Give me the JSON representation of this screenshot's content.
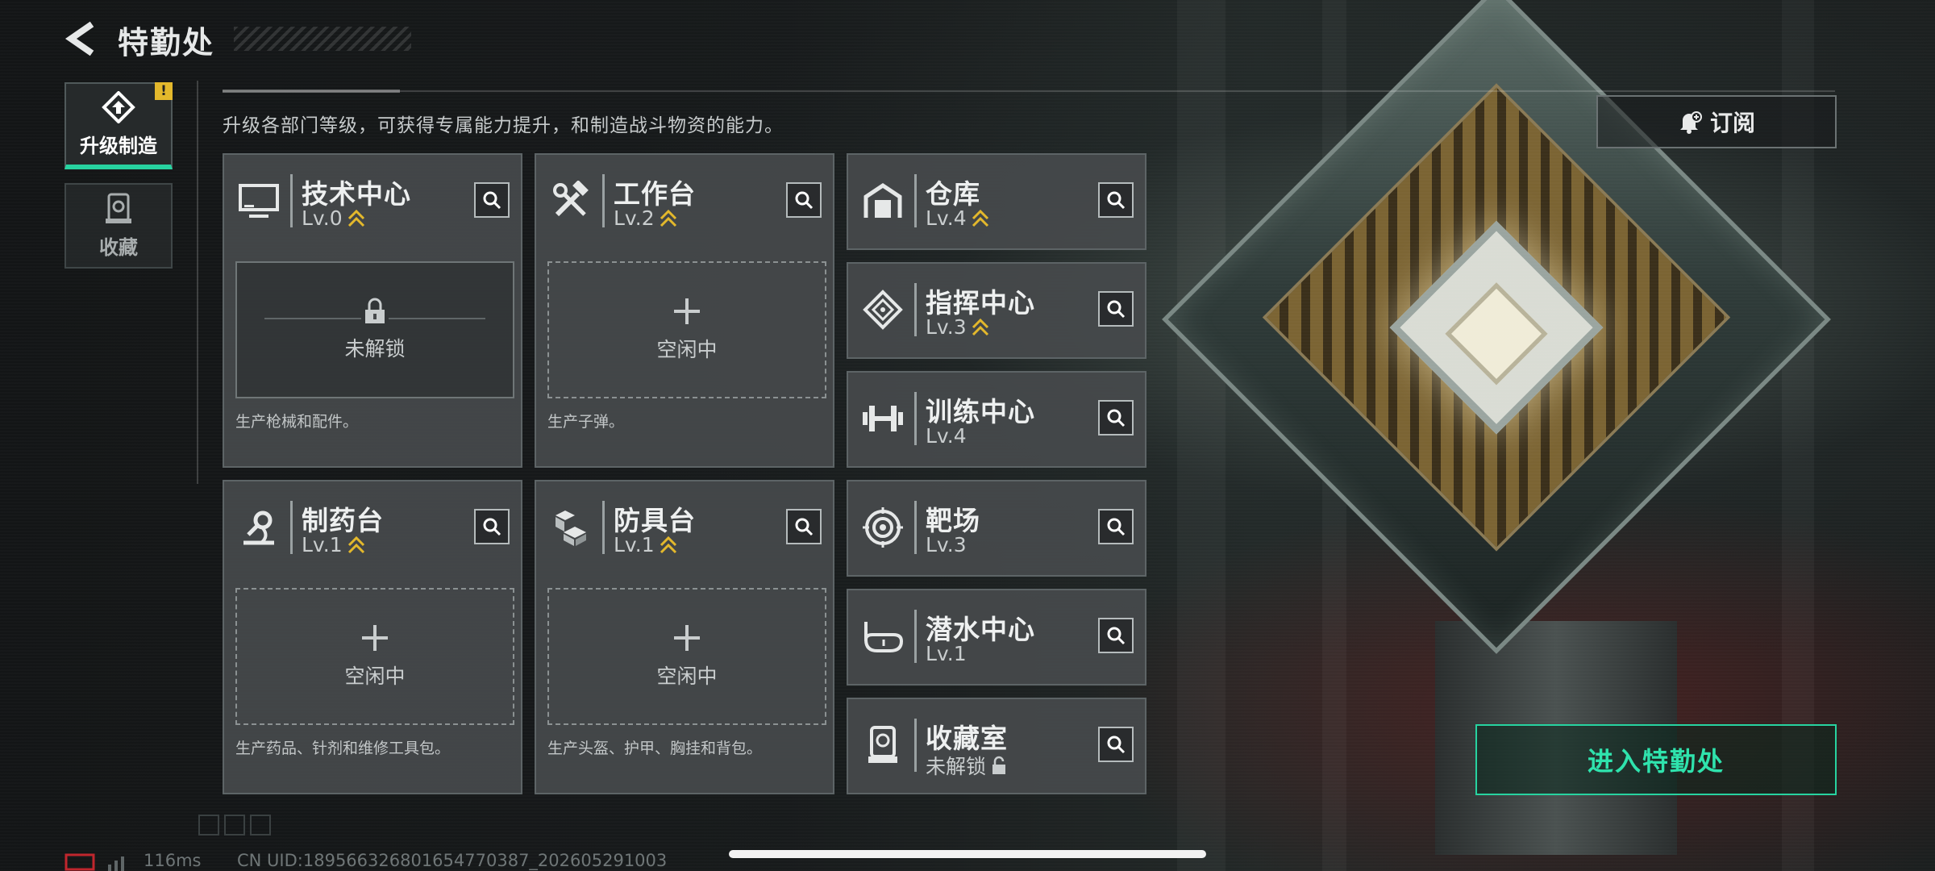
{
  "header": {
    "title": "特勤处"
  },
  "tabs": [
    {
      "label": "升级制造",
      "badge": "!",
      "active": true
    },
    {
      "label": "收藏"
    }
  ],
  "subtitle": "升级各部门等级，可获得专属能力提升，和制造战斗物资的能力。",
  "production_departments": [
    {
      "name": "技术中心",
      "level": "Lv.0",
      "upgradable": true,
      "icon": "monitor-icon",
      "status": "未解锁",
      "locked": true,
      "description": "生产枪械和配件。"
    },
    {
      "name": "工作台",
      "level": "Lv.2",
      "upgradable": true,
      "icon": "hammer-wrench-icon",
      "status": "空闲中",
      "locked": false,
      "description": "生产子弹。"
    },
    {
      "name": "制药台",
      "level": "Lv.1",
      "upgradable": true,
      "icon": "microscope-icon",
      "status": "空闲中",
      "locked": false,
      "description": "生产药品、针剂和维修工具包。"
    },
    {
      "name": "防具台",
      "level": "Lv.1",
      "upgradable": true,
      "icon": "cubes-icon",
      "status": "空闲中",
      "locked": false,
      "description": "生产头盔、护甲、胸挂和背包。"
    }
  ],
  "facilities": [
    {
      "name": "仓库",
      "level": "Lv.4",
      "upgradable": true,
      "icon": "warehouse-icon"
    },
    {
      "name": "指挥中心",
      "level": "Lv.3",
      "upgradable": true,
      "icon": "diamond-target-icon"
    },
    {
      "name": "训练中心",
      "level": "Lv.4",
      "upgradable": false,
      "icon": "dumbbell-icon"
    },
    {
      "name": "靶场",
      "level": "Lv.3",
      "upgradable": false,
      "icon": "target-icon"
    },
    {
      "name": "潜水中心",
      "level": "Lv.1",
      "upgradable": false,
      "icon": "diving-mask-icon"
    },
    {
      "name": "收藏室",
      "level": "未解锁",
      "upgradable": false,
      "locked": true,
      "icon": "trophy-case-icon"
    }
  ],
  "subscribe": {
    "label": "订阅",
    "icon": "bell-plus-icon"
  },
  "enter_button": {
    "label": "进入特勤处"
  },
  "footer": {
    "ping": "116ms",
    "uid": "CN UID:1895663268016547703​87_202605291003"
  },
  "colors": {
    "accent": "#27d3a0",
    "upgrade_arrow": "#e3b82c",
    "badge": "#e3b82c"
  }
}
